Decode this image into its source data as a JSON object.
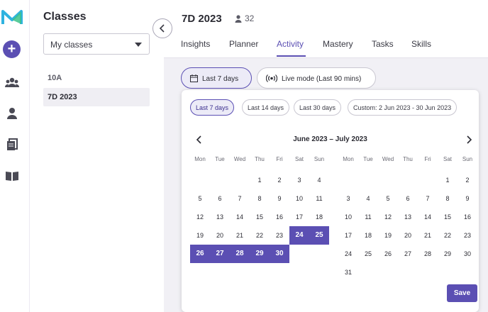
{
  "app": {
    "brand_colors": {
      "accent": "#5b4fb3",
      "accent_light": "#ecebf7",
      "logo_blue": "#2fb3e0",
      "logo_green": "#3ec28a"
    }
  },
  "rail": {
    "icons": [
      "logo-icon",
      "add-icon",
      "users-icon",
      "user-icon",
      "pages-icon",
      "book-icon"
    ],
    "add_label": "+"
  },
  "sidebar": {
    "title": "Classes",
    "filter_value": "My classes",
    "classes": [
      "10A",
      "7D 2023"
    ],
    "active_class": "7D 2023"
  },
  "class_header": {
    "title": "7D 2023",
    "student_count": "32",
    "tabs": [
      "Insights",
      "Planner",
      "Activity",
      "Mastery",
      "Tasks",
      "Skills"
    ],
    "active_tab": "Activity"
  },
  "filters": {
    "date_pill": "Last 7 days",
    "live_pill": "Live mode (Last 90 mins)"
  },
  "datepicker": {
    "presets": [
      "Last 7 days",
      "Last 14 days",
      "Last 30 days",
      "Custom: 2 Jun 2023 - 30 Jun 2023"
    ],
    "active_preset": "Last 7 days",
    "range_label": "June 2023 – July 2023",
    "weekdays": [
      "Mon",
      "Tue",
      "Wed",
      "Thu",
      "Fri",
      "Sat",
      "Sun"
    ],
    "june": [
      [
        "",
        "",
        "",
        "1",
        "2",
        "3",
        "4"
      ],
      [
        "5",
        "6",
        "7",
        "8",
        "9",
        "10",
        "11"
      ],
      [
        "12",
        "13",
        "14",
        "15",
        "16",
        "17",
        "18"
      ],
      [
        "19",
        "20",
        "21",
        "22",
        "23",
        "24",
        "25"
      ],
      [
        "26",
        "27",
        "28",
        "29",
        "30",
        "",
        ""
      ]
    ],
    "july": [
      [
        "",
        "",
        "",
        "",
        "",
        "1",
        "2"
      ],
      [
        "3",
        "4",
        "5",
        "6",
        "7",
        "8",
        "9"
      ],
      [
        "10",
        "11",
        "12",
        "13",
        "14",
        "15",
        "16"
      ],
      [
        "17",
        "18",
        "19",
        "20",
        "21",
        "22",
        "23"
      ],
      [
        "24",
        "25",
        "26",
        "27",
        "28",
        "29",
        "30"
      ],
      [
        "31",
        "",
        "",
        "",
        "",
        "",
        ""
      ]
    ],
    "selected_june_days": [
      "24",
      "25",
      "26",
      "27",
      "28",
      "29",
      "30"
    ],
    "save_label": "Save"
  }
}
